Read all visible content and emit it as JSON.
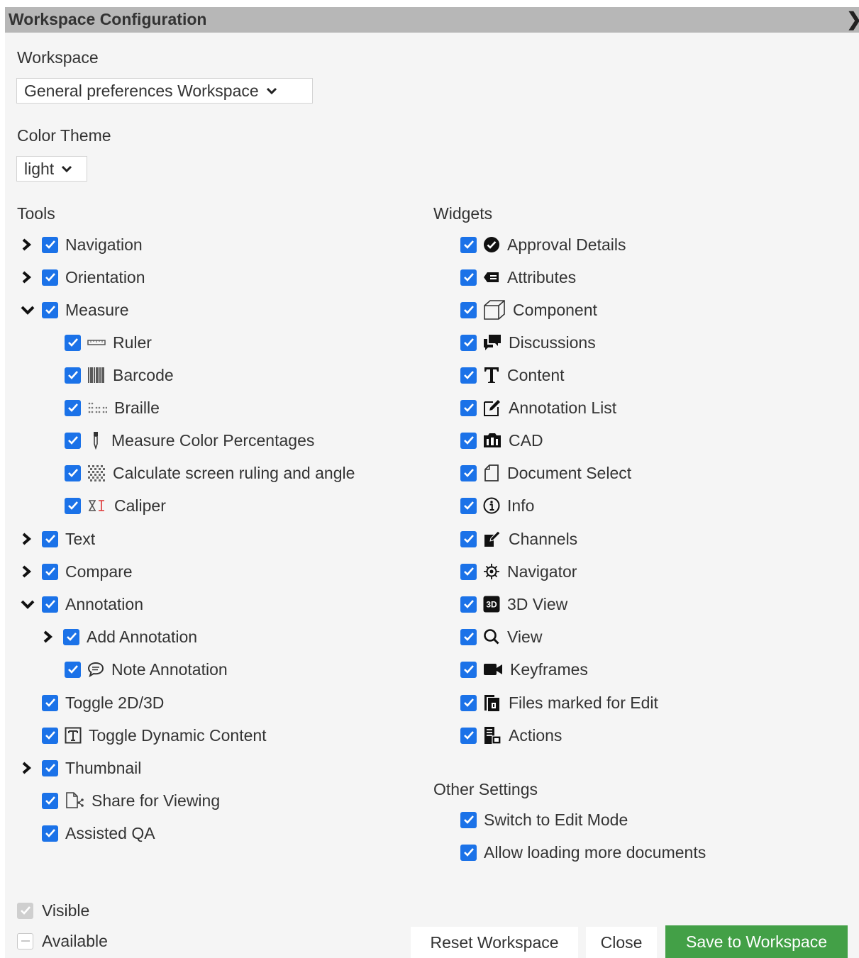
{
  "window": {
    "title": "Workspace Configuration",
    "close_icon": "chevron-right-icon"
  },
  "workspace": {
    "label": "Workspace",
    "selected": "General preferences Workspace"
  },
  "color_theme": {
    "label": "Color Theme",
    "selected": "light"
  },
  "tools": {
    "heading": "Tools",
    "items": [
      {
        "label": "Navigation",
        "expander": "collapsed",
        "checked": true
      },
      {
        "label": "Orientation",
        "expander": "collapsed",
        "checked": true
      },
      {
        "label": "Measure",
        "expander": "expanded",
        "checked": true
      },
      {
        "label": "Ruler",
        "icon": "ruler-icon",
        "checked": true
      },
      {
        "label": "Barcode",
        "icon": "barcode-icon",
        "checked": true
      },
      {
        "label": "Braille",
        "icon": "braille-icon",
        "checked": true
      },
      {
        "label": "Measure Color Percentages",
        "icon": "eyedropper-icon",
        "checked": true
      },
      {
        "label": "Calculate screen ruling and angle",
        "icon": "screen-ruling-icon",
        "checked": true
      },
      {
        "label": "Caliper",
        "icon": "caliper-icon",
        "checked": true
      },
      {
        "label": "Text",
        "expander": "collapsed",
        "checked": true
      },
      {
        "label": "Compare",
        "expander": "collapsed",
        "checked": true
      },
      {
        "label": "Annotation",
        "expander": "expanded",
        "checked": true
      },
      {
        "label": "Add Annotation",
        "expander": "collapsed",
        "checked": true
      },
      {
        "label": "Note Annotation",
        "icon": "speech-bubble-icon",
        "checked": true
      },
      {
        "label": "Toggle 2D/3D",
        "checked": true
      },
      {
        "label": "Toggle Dynamic Content",
        "icon": "text-box-icon",
        "checked": true
      },
      {
        "label": "Thumbnail",
        "expander": "collapsed",
        "checked": true
      },
      {
        "label": "Share for Viewing",
        "icon": "share-document-icon",
        "checked": true
      },
      {
        "label": "Assisted QA",
        "checked": true
      }
    ]
  },
  "widgets": {
    "heading": "Widgets",
    "items": [
      {
        "label": "Approval Details",
        "icon": "check-circle-icon",
        "checked": true
      },
      {
        "label": "Attributes",
        "icon": "tag-icon",
        "checked": true
      },
      {
        "label": "Component",
        "icon": "cube-icon",
        "checked": true
      },
      {
        "label": "Discussions",
        "icon": "comments-icon",
        "checked": true
      },
      {
        "label": "Content",
        "icon": "text-t-icon",
        "checked": true
      },
      {
        "label": "Annotation List",
        "icon": "edit-note-icon",
        "checked": true
      },
      {
        "label": "CAD",
        "icon": "cad-icon",
        "checked": true
      },
      {
        "label": "Document Select",
        "icon": "document-icon",
        "checked": true
      },
      {
        "label": "Info",
        "icon": "info-circle-icon",
        "checked": true
      },
      {
        "label": "Channels",
        "icon": "channels-icon",
        "checked": true
      },
      {
        "label": "Navigator",
        "icon": "navigator-icon",
        "checked": true
      },
      {
        "label": "3D View",
        "icon": "3d-badge-icon",
        "checked": true
      },
      {
        "label": "View",
        "icon": "search-icon",
        "checked": true
      },
      {
        "label": "Keyframes",
        "icon": "video-camera-icon",
        "checked": true
      },
      {
        "label": "Files marked for Edit",
        "icon": "files-edit-icon",
        "checked": true
      },
      {
        "label": "Actions",
        "icon": "actions-icon",
        "checked": true
      }
    ]
  },
  "other_settings": {
    "heading": "Other Settings",
    "items": [
      {
        "label": "Switch to Edit Mode",
        "checked": true
      },
      {
        "label": "Allow loading more documents",
        "checked": true
      }
    ]
  },
  "legend": {
    "visible_label": "Visible",
    "available_label": "Available"
  },
  "buttons": {
    "reset": "Reset Workspace",
    "close": "Close",
    "save": "Save to Workspace"
  },
  "colors": {
    "checkbox": "#1b72e8",
    "save_button": "#43a047",
    "title_bar": "#b7b7b7"
  }
}
